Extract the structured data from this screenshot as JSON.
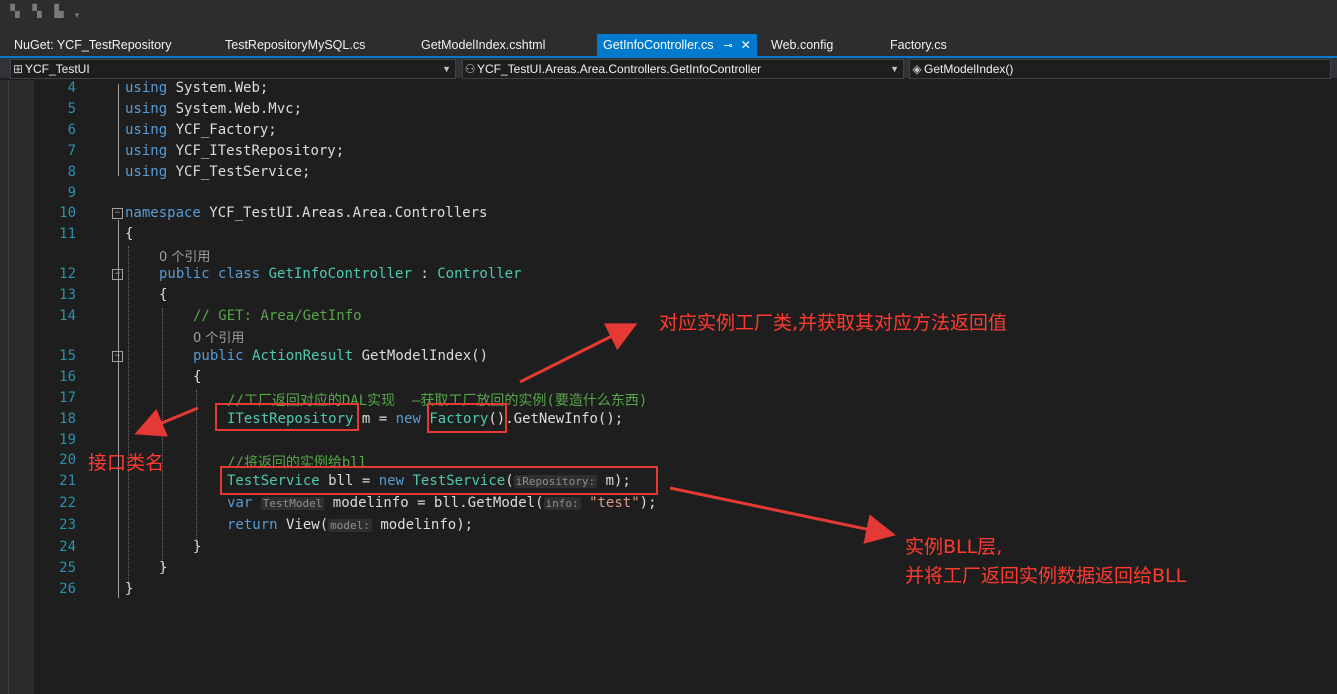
{
  "tabs": [
    {
      "label": "NuGet: YCF_TestRepository"
    },
    {
      "label": "TestRepositoryMySQL.cs"
    },
    {
      "label": "GetModelIndex.cshtml"
    },
    {
      "label": "GetInfoController.cs",
      "active": true
    },
    {
      "label": "Web.config"
    },
    {
      "label": "Factory.cs"
    }
  ],
  "nav": {
    "project": "YCF_TestUI",
    "class": "YCF_TestUI.Areas.Area.Controllers.GetInfoController",
    "member": "GetModelIndex()"
  },
  "lines": {
    "l4": "4",
    "l5": "5",
    "l6": "6",
    "l7": "7",
    "l8": "8",
    "l9": "9",
    "l10": "10",
    "l11": "11",
    "l12": "12",
    "l13": "13",
    "l14": "14",
    "l15": "15",
    "l16": "16",
    "l17": "17",
    "l18": "18",
    "l19": "19",
    "l20": "20",
    "l21": "21",
    "l22": "22",
    "l23": "23",
    "l24": "24",
    "l25": "25",
    "l26": "26"
  },
  "code": {
    "using": "using",
    "u1": "System.Web;",
    "u2": "System.Web.Mvc;",
    "u3": "YCF_Factory;",
    "u4": "YCF_ITestRepository;",
    "u5": "YCF_TestService;",
    "namespace_kw": "namespace",
    "namespace_name": "YCF_TestUI.Areas.Area.Controllers",
    "open_brace": "{",
    "close_brace": "}",
    "refs": "0 个引用",
    "public": "public",
    "class": "class",
    "class_name": "GetInfoController",
    "colon": ":",
    "base": "Controller",
    "comment_get": "// GET: Area/GetInfo",
    "action_result": "ActionResult",
    "method": "GetModelIndex()",
    "comment_factory": "//工厂返回对应的DAL实现  —获取工厂放回的实例(要造什么东西)",
    "itest": "ITestRepository",
    "m_eq": "m =",
    "new": "new",
    "factory": "Factory",
    "parens": "()",
    "getnewinfo": ".GetNewInfo();",
    "comment_bll": "//将返回的实例给bll",
    "testservice": "TestService",
    "bll_eq": "bll =",
    "paren_open": "(",
    "hint_irepo": "iRepository:",
    "m_close": "m);",
    "var": "var",
    "hint_testmodel": "TestModel",
    "modelinfo_eq": "modelinfo = bll.GetModel(",
    "hint_info": "info:",
    "test_str": "\"test\"",
    "close_semi": ");",
    "return": "return",
    "view": "View(",
    "hint_model": "model:",
    "modelinfo_close": "modelinfo);"
  },
  "annotations": {
    "factory_note": "对应实例工厂类,并获取其对应方法返回值",
    "interface_note": "接口类名",
    "bll_note_line1": "实例BLL层,",
    "bll_note_line2": "并将工厂返回实例数据返回给BLL"
  },
  "colors": {
    "accent": "#007acc",
    "annotation": "#e53935"
  }
}
